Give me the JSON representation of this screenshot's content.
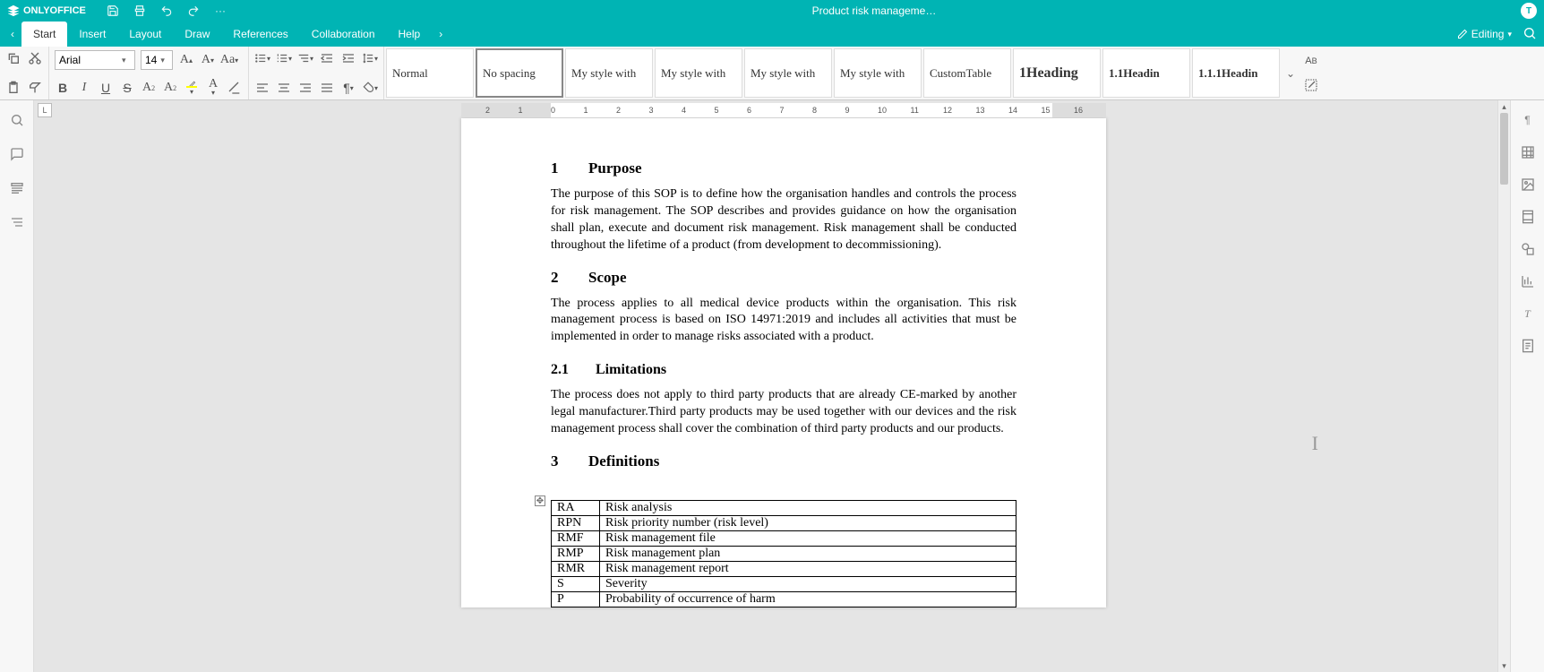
{
  "app": {
    "name": "ONLYOFFICE",
    "title": "Product risk manageme…",
    "avatar": "T"
  },
  "menubar": {
    "editing": "Editing",
    "tabs": [
      "Start",
      "Insert",
      "Layout",
      "Draw",
      "References",
      "Collaboration",
      "Help"
    ],
    "active": 0
  },
  "font": {
    "name": "Arial",
    "size": "14"
  },
  "styles": [
    "Normal",
    "No spacing",
    "My style with",
    "My style with",
    "My style with",
    "My style with",
    "CustomTable",
    "1Heading",
    "1.1Headin",
    "1.1.1Headin"
  ],
  "styles_active": 1,
  "doc": {
    "sections": [
      {
        "num": "1",
        "title": "Purpose",
        "body": "The purpose of this SOP is to define how the organisation handles and controls the process for risk management. The SOP describes and provides guidance on how the organisation shall plan, execute and document risk management. Risk management shall be conducted throughout the lifetime of a product (from development to decommissioning)."
      },
      {
        "num": "2",
        "title": "Scope",
        "body": "The process applies to all medical device products within the organisation. This risk management process is based on ISO 14971:2019 and includes all  activities that must be implemented in order to manage risks associated with a product."
      },
      {
        "num": "2.1",
        "title": "Limitations",
        "level": "sub",
        "body": "The process does not apply to third party products that are already CE-marked by another legal manufacturer.Third party products may be used together with our devices and the risk management process shall cover the combination of third party products and our products."
      },
      {
        "num": "3",
        "title": "Definitions"
      }
    ],
    "definitions": [
      [
        "RA",
        "Risk analysis"
      ],
      [
        "RPN",
        "Risk priority number (risk level)"
      ],
      [
        "RMF",
        "Risk management file"
      ],
      [
        "RMP",
        "Risk management plan"
      ],
      [
        "RMR",
        "Risk management report"
      ],
      [
        "S",
        "Severity"
      ],
      [
        "P",
        "Probability of occurrence of harm"
      ]
    ]
  }
}
